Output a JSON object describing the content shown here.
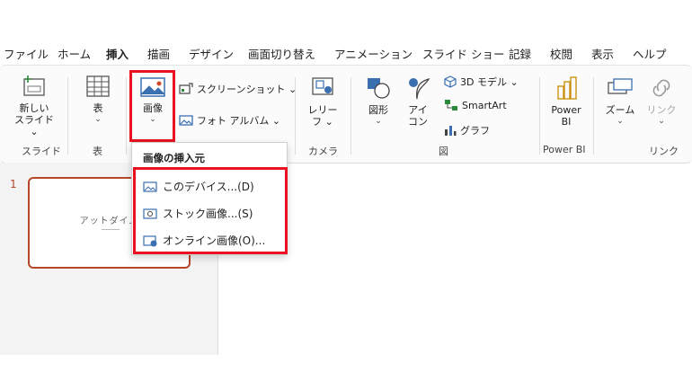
{
  "tabs": [
    {
      "label": "ファイル"
    },
    {
      "label": "ホーム"
    },
    {
      "label": "挿入"
    },
    {
      "label": "描画"
    },
    {
      "label": "デザイン"
    },
    {
      "label": "画面切り替え"
    },
    {
      "label": "アニメーション"
    },
    {
      "label": "スライド ショー"
    },
    {
      "label": "記録"
    },
    {
      "label": "校閲"
    },
    {
      "label": "表示"
    },
    {
      "label": "ヘルプ"
    }
  ],
  "active_tab": "挿入",
  "ribbon": {
    "new_slide": {
      "label1": "新しい",
      "label2": "スライド ⌄"
    },
    "table": {
      "label": "表",
      "chev": "⌄"
    },
    "image": {
      "label": "画像",
      "chev": "⌄"
    },
    "screenshot": {
      "label": "スクリーンショット ⌄"
    },
    "photo_album": {
      "label": "フォト アルバム ⌄"
    },
    "cameo": {
      "label1": "レリー",
      "label2": "フ ⌄"
    },
    "shapes": {
      "label": "図形",
      "chev": "⌄"
    },
    "icons": {
      "label1": "アイ",
      "label2": "コン"
    },
    "model3d": {
      "label": "3D モデル ⌄"
    },
    "smartart": {
      "label": "SmartArt"
    },
    "chart": {
      "label": "グラフ"
    },
    "powerbi": {
      "label1": "Power",
      "label2": "BI"
    },
    "zoom": {
      "label": "ズーム",
      "chev": "⌄"
    },
    "link": {
      "label": "リンク",
      "chev": "⌄"
    },
    "groups": {
      "slides": "スライド",
      "tables": "表",
      "camera": "カメラ",
      "illustrations": "図",
      "powerbi": "Power BI",
      "links": "リンク"
    }
  },
  "dropdown": {
    "header": "画像の挿入元",
    "items": [
      {
        "label": "このデバイス...(D)"
      },
      {
        "label": "ストック画像...(S)"
      },
      {
        "label": "オンライン画像(O)..."
      }
    ]
  },
  "slide_pane": {
    "slide_number": "1",
    "thumb_title": "アットダイム"
  },
  "colors": {
    "accent": "#c43e1c",
    "highlight": "#e8131e",
    "thumb_border": "#b7472a"
  }
}
